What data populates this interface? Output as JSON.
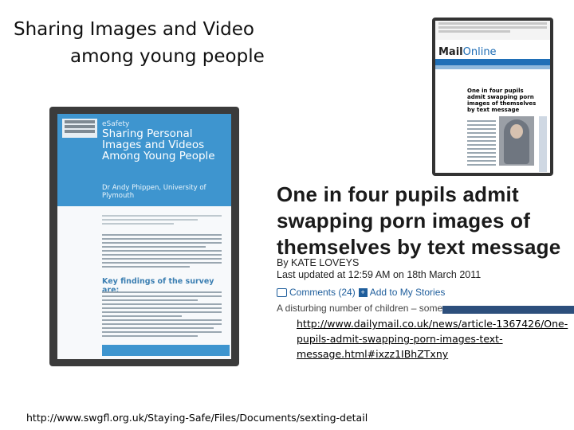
{
  "slide": {
    "title_line1": "Sharing Images and Video",
    "title_line2": "among young people"
  },
  "report": {
    "tag": "eSafety",
    "title": "Sharing Personal Images and Videos Among Young People",
    "author": "Dr Andy Phippen, University of Plymouth",
    "key_heading": "Key findings of the survey are:"
  },
  "dailymail": {
    "logo_main": "Mail",
    "logo_sub": "Online",
    "mini_headline": "One in four pupils admit swapping porn images of themselves by text message",
    "headline": "One in four pupils admit swapping porn images of themselves by text message",
    "byline": "By KATE LOVEYS",
    "updated": "Last updated at 12:59 AM on 18th March 2011",
    "comments": "Comments (24)",
    "add_to_stories": "Add to My Stories",
    "snippet": "A disturbing number of children – some"
  },
  "links": {
    "dailymail_url": "http://www.dailymail.co.uk/news/article-1367426/One-pupils-admit-swapping-porn-images-text-message.html#ixzz1IBhZTxny",
    "swgfl_url": "http://www.swgfl.org.uk/Staying-Safe/Files/Documents/sexting-detail"
  },
  "colors": {
    "report_blue": "#3e95cf",
    "link_blue": "#1f5e9c",
    "dm_nav_blue": "#1f6fb7"
  }
}
